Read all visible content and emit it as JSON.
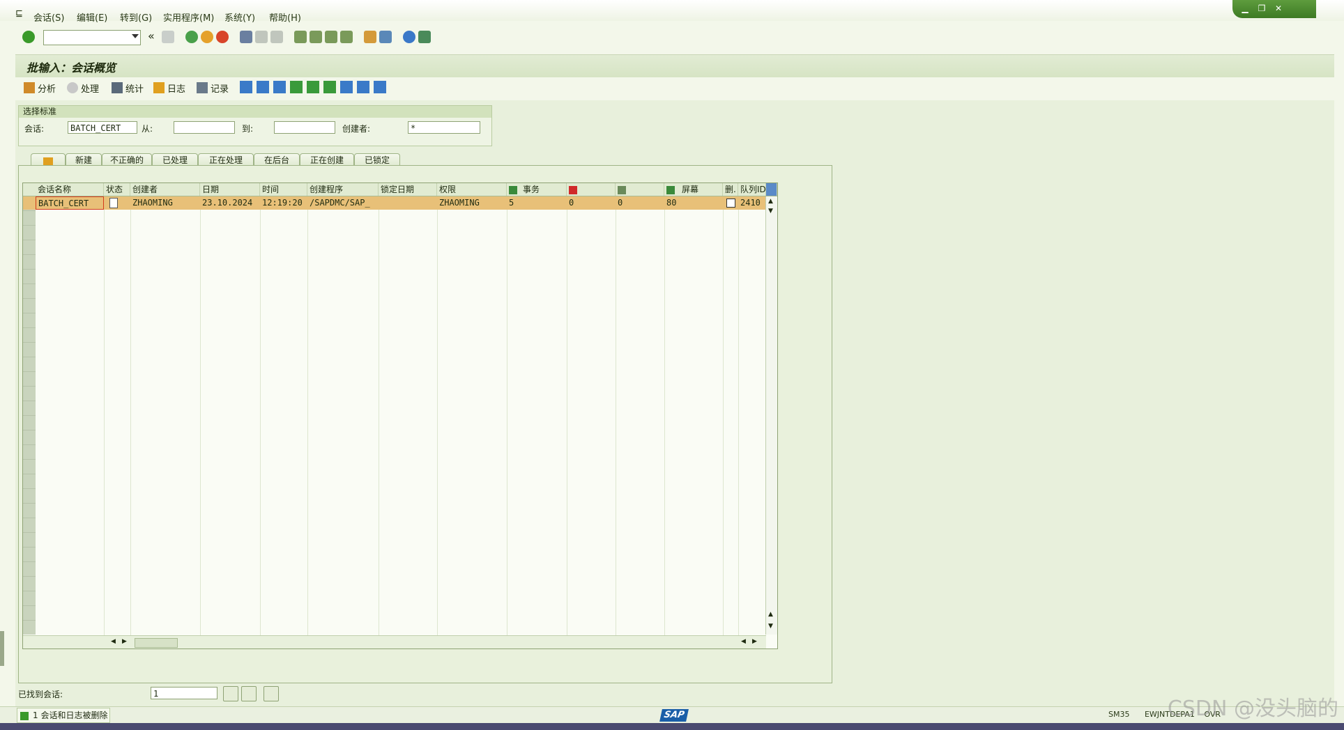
{
  "menu": {
    "items": [
      "会话(S)",
      "编辑(E)",
      "转到(G)",
      "实用程序(M)",
      "系统(Y)",
      "帮助(H)"
    ]
  },
  "title": "批输入：会话概览",
  "app_toolbar": {
    "analyze": "分析",
    "process": "处理",
    "statistics": "统计",
    "log": "日志",
    "record": "记录"
  },
  "selection": {
    "header": "选择标准",
    "session_label": "会话:",
    "session_value": "BATCH_CERT",
    "from_label": "从:",
    "from_value": "",
    "to_label": "到:",
    "to_value": "",
    "creator_label": "创建者:",
    "creator_value": "*"
  },
  "tabs": [
    "新建",
    "不正确的",
    "已处理",
    "正在处理",
    "在后台",
    "正在创建",
    "已锁定"
  ],
  "grid": {
    "columns": [
      "会话名称",
      "状态",
      "创建者",
      "日期",
      "时间",
      "创建程序",
      "锁定日期",
      "权限",
      "事务",
      "",
      "",
      "屏幕",
      "删.",
      "队列ID"
    ],
    "rows": [
      {
        "name": "BATCH_CERT",
        "status": "",
        "creator": "ZHAOMING",
        "date": "23.10.2024",
        "time": "12:19:20",
        "program": "/SAPDMC/SAP_",
        "lock_date": "",
        "authority": "ZHAOMING",
        "transactions": "5",
        "errors": "0",
        "processed": "0",
        "screens": "80",
        "queue": "2410"
      }
    ]
  },
  "bottom": {
    "found_label": "已找到会话:",
    "found_value": "1"
  },
  "status": {
    "message": "1 会话和日志被删除",
    "system": "SM35",
    "server": "EWJNTDEPA1",
    "mode": "OVR"
  },
  "watermark": "CSDN @没头脑的",
  "colors": {
    "background": "#f3f7ea",
    "selected_row": "#e8c078",
    "accent_green": "#3d7a24",
    "sap_blue": "#1a5ea8"
  }
}
